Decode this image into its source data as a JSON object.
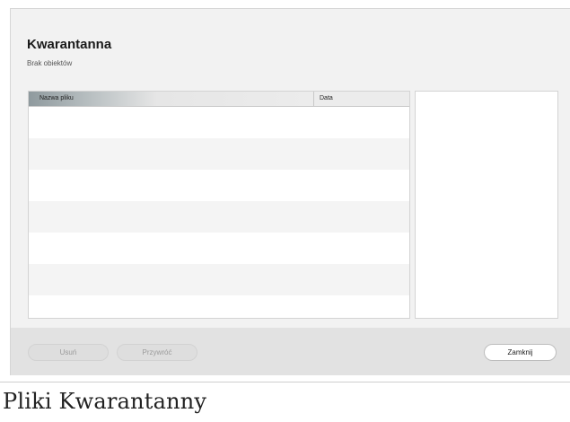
{
  "dialog": {
    "title": "Kwarantanna",
    "subtitle": "Brak obiektów"
  },
  "table": {
    "columns": [
      "Nazwa pliku",
      "Data"
    ],
    "rows": []
  },
  "buttons": {
    "delete_label": "Usuń",
    "restore_label": "Przywróć",
    "close_label": "Zamknij"
  },
  "caption": "Pliki Kwarantanny"
}
